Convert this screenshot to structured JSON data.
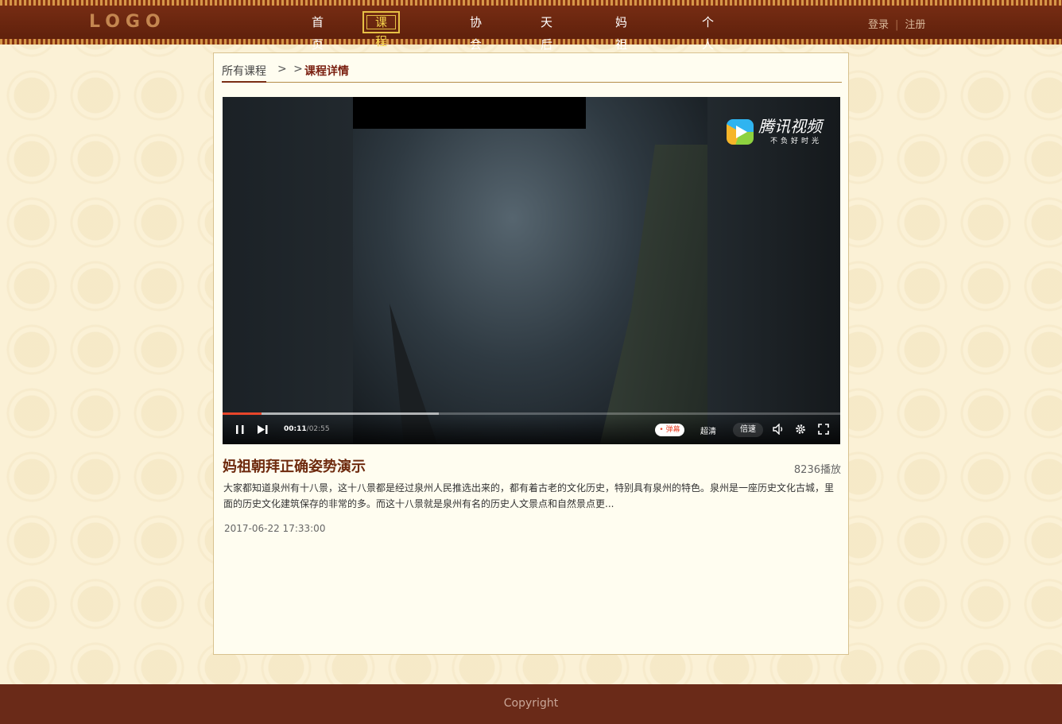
{
  "header": {
    "logo": "LOGO",
    "nav": [
      "首页",
      "课程学院",
      "协会",
      "天后宫",
      "妈祖世界",
      "个人中心"
    ],
    "active_nav": "课程学院",
    "login": "登录",
    "register": "注册"
  },
  "breadcrumb": {
    "all_courses": "所有课程",
    "separator": "> >",
    "current": "课程详情"
  },
  "video": {
    "brand_name": "腾讯视频",
    "brand_slogan": "不负好时光",
    "current_time": "00:11",
    "duration": "/02:55",
    "played_fraction": 0.063,
    "buffered_fraction": 0.35,
    "danmu_label": "弹幕",
    "quality_label": "超清",
    "speed_label": "倍速"
  },
  "course": {
    "title": "妈祖朝拜正确姿势演示",
    "views": "8236播放",
    "description": "大家都知道泉州有十八景，这十八景都是经过泉州人民推选出来的，都有着古老的文化历史，特别具有泉州的特色。泉州是一座历史文化古城，里面的历史文化建筑保存的非常的多。而这十八景就是泉州有名的历史人文景点和自然景点更...",
    "date": "2017-06-22 17:33:00"
  },
  "footer": {
    "copyright": "Copyright"
  },
  "colors": {
    "header": "#6a2a18",
    "accent": "#f5d34c",
    "title": "#6e2a0e",
    "progress": "#e8462b"
  }
}
